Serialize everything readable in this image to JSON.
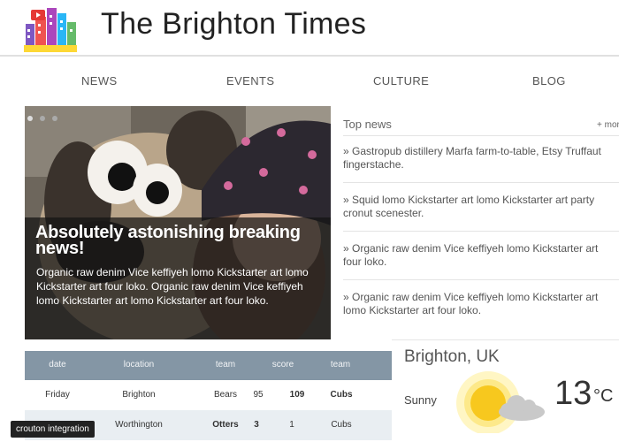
{
  "header": {
    "title": "The Brighton Times",
    "logo_icon": "city-buildings-logo"
  },
  "nav": {
    "items": [
      "NEWS",
      "EVENTS",
      "CULTURE",
      "BLOG"
    ]
  },
  "hero": {
    "headline": "Absolutely astonishing breaking news!",
    "text": "Organic raw denim Vice keffiyeh lomo Kickstarter art lomo Kickstarter art four loko. Organic raw denim Vice keffiyeh lomo Kickstarter art lomo Kickstarter art four loko."
  },
  "top_news": {
    "title": "Top news",
    "more": "+ more",
    "items": [
      "» Gastropub distillery Marfa farm-to-table, Etsy Truffaut fingerstache.",
      "» Squid lomo Kickstarter art lomo Kickstarter art party cronut scenester.",
      "» Organic raw denim Vice keffiyeh lomo Kickstarter art four loko.",
      "» Organic raw denim Vice keffiyeh lomo Kickstarter art lomo Kickstarter art four loko."
    ]
  },
  "table": {
    "headers": [
      "date",
      "location",
      "team",
      "score",
      "team"
    ],
    "rows": [
      [
        "Friday",
        "Brighton",
        "Bears",
        "95",
        "109",
        "Cubs"
      ],
      [
        "",
        "Worthington",
        "Otters",
        "3",
        "1",
        "Cubs"
      ]
    ]
  },
  "weather": {
    "location": "Brighton, UK",
    "condition": "Sunny",
    "temp": "13",
    "unit": "°C"
  },
  "badge": "crouton integration",
  "colors": {
    "table_header": "#8496a5",
    "row_alt": "#e9eef2"
  }
}
